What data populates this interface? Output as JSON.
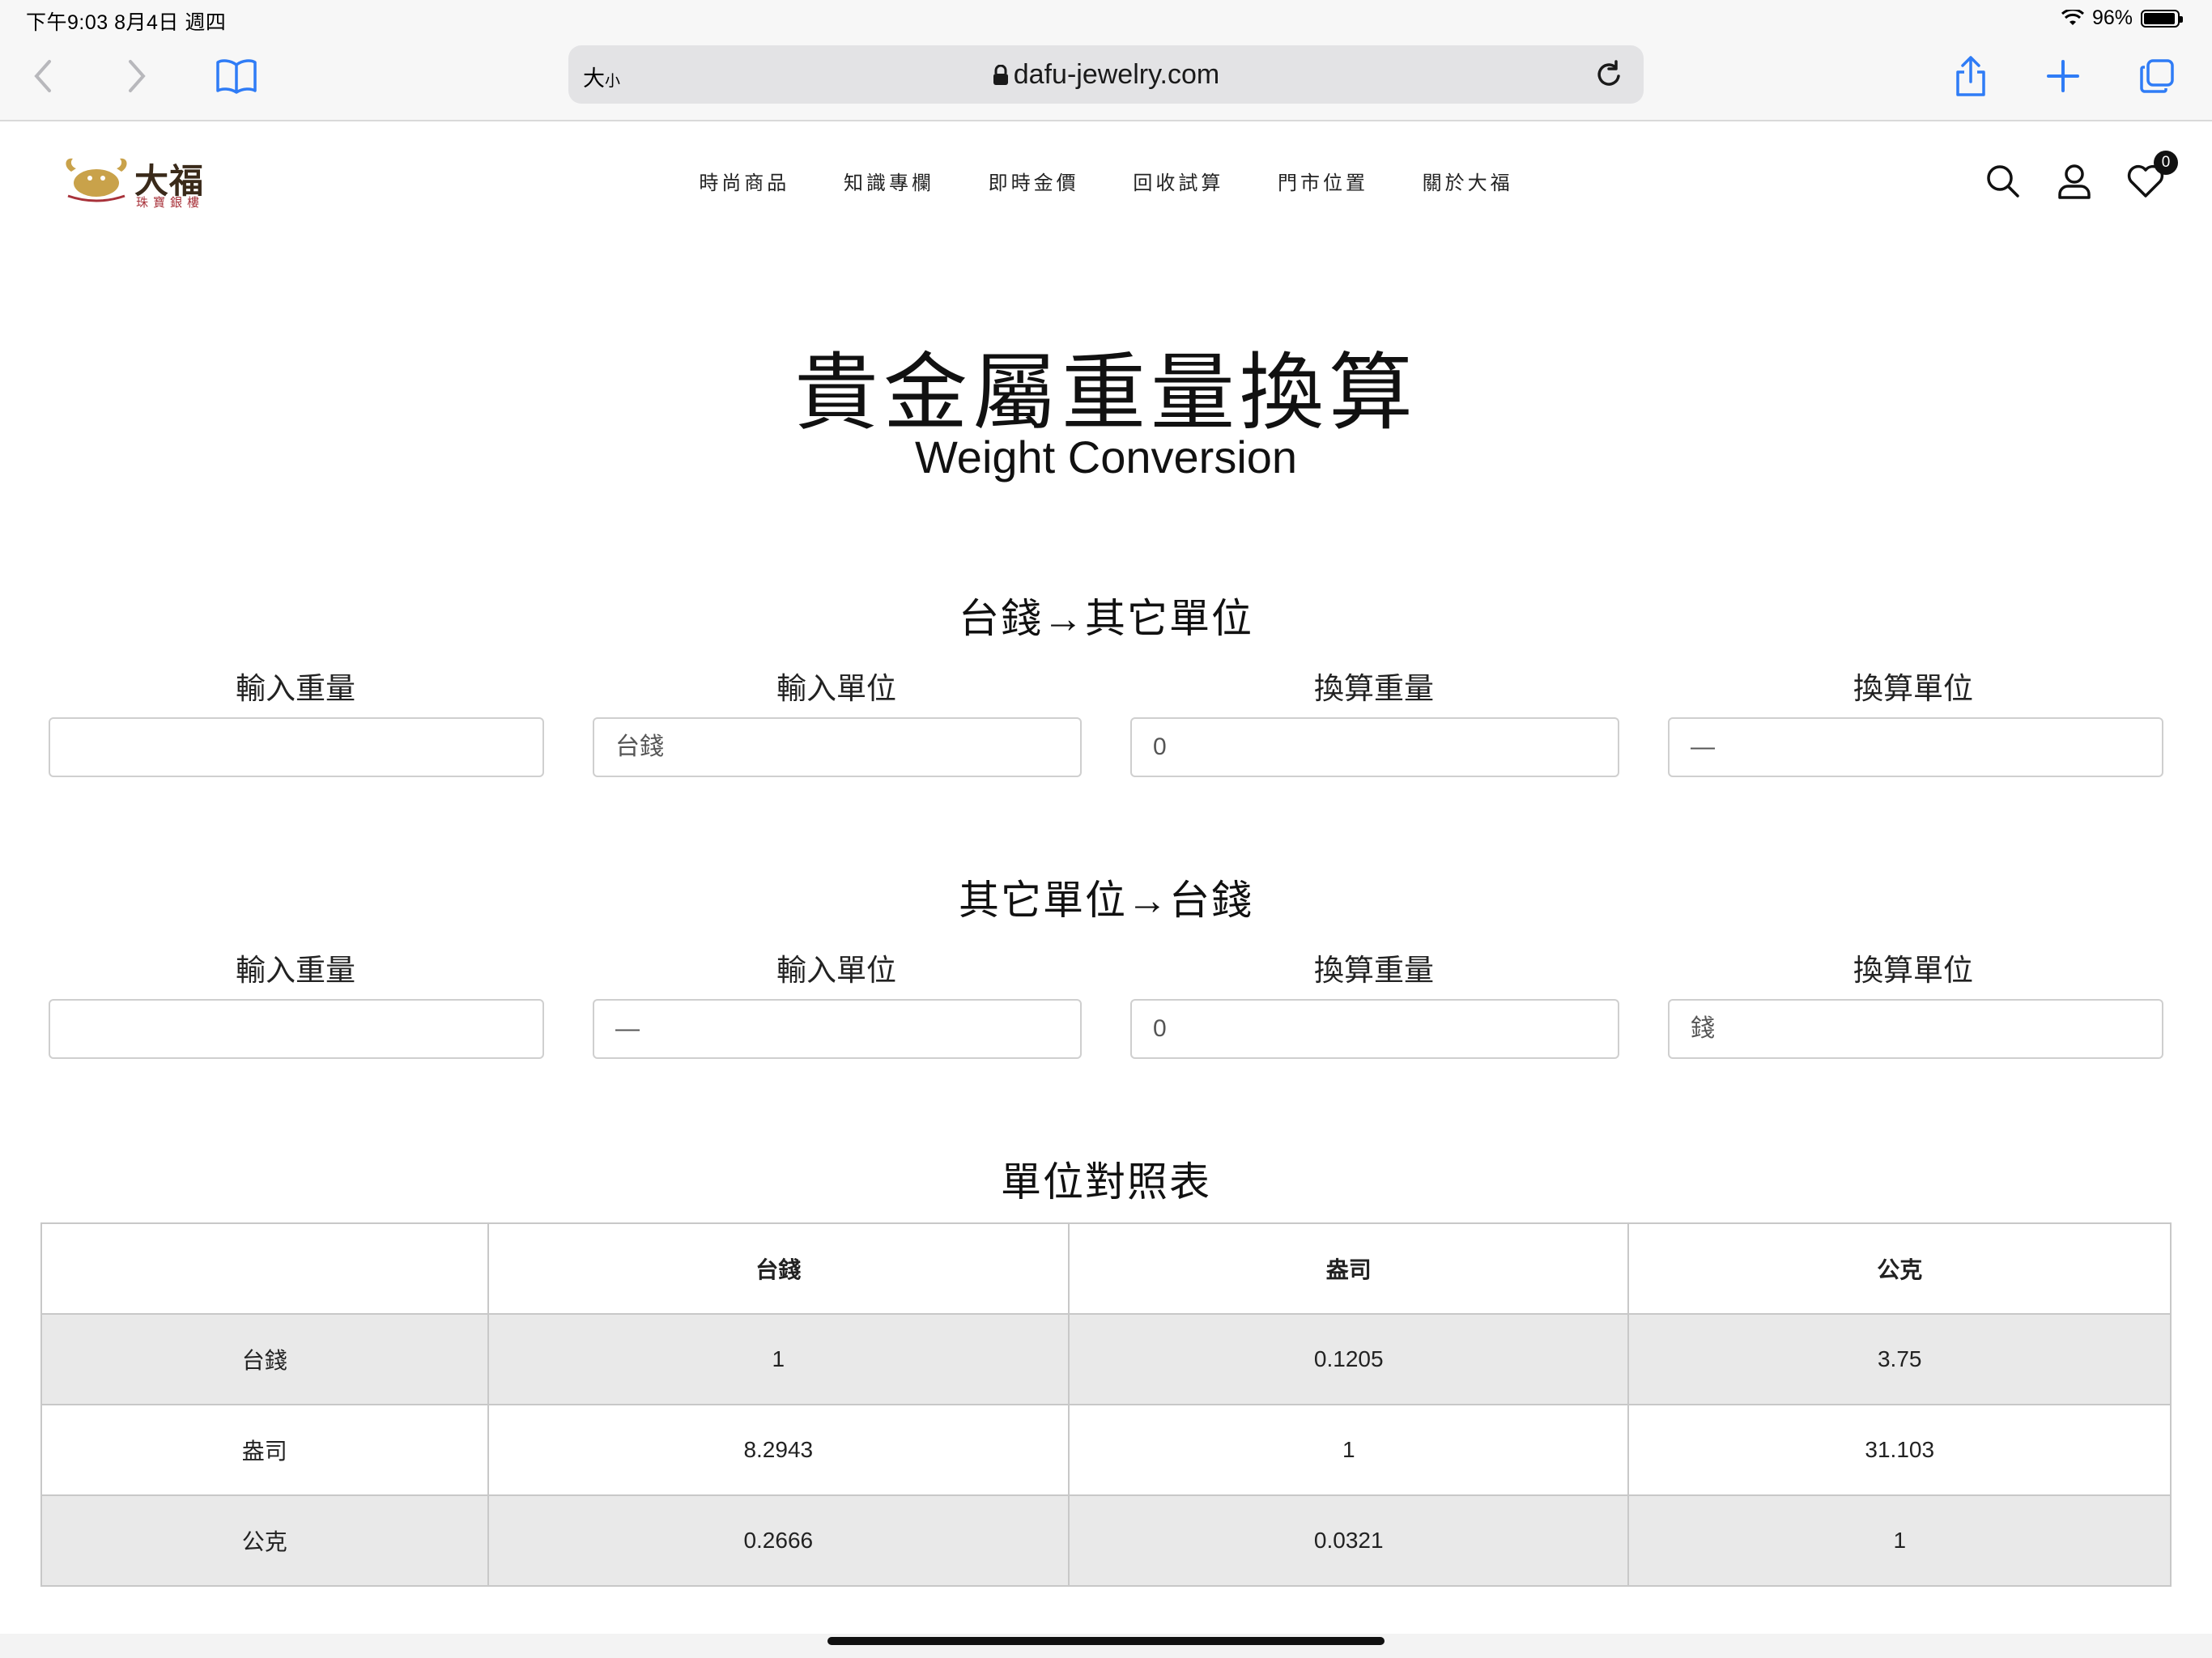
{
  "status_bar": {
    "time_date": "下午9:03   8月4日 週四",
    "battery": "96%",
    "battery_level": 0.96
  },
  "browser": {
    "text_size_label_big": "大",
    "text_size_label_small": "小",
    "url": "dafu-jewelry.com"
  },
  "site": {
    "logo_text": "大福",
    "logo_sub": "珠寶銀樓",
    "nav": [
      "時尚商品",
      "知識專欄",
      "即時金價",
      "回收試算",
      "門市位置",
      "關於大福"
    ],
    "wishlist_count": "0"
  },
  "page": {
    "title": "貴金屬重量換算",
    "subtitle": "Weight Conversion"
  },
  "section1": {
    "title": "台錢→其它單位",
    "labels": [
      "輸入重量",
      "輸入單位",
      "換算重量",
      "換算單位"
    ],
    "input_weight": "",
    "input_unit": "台錢",
    "result_weight": "0",
    "result_unit": "—"
  },
  "section2": {
    "title": "其它單位→台錢",
    "labels": [
      "輸入重量",
      "輸入單位",
      "換算重量",
      "換算單位"
    ],
    "input_weight": "",
    "input_unit": "—",
    "result_weight": "0",
    "result_unit": "錢"
  },
  "table": {
    "title": "單位對照表",
    "headers": [
      "",
      "台錢",
      "盎司",
      "公克"
    ],
    "rows": [
      [
        "台錢",
        "1",
        "0.1205",
        "3.75"
      ],
      [
        "盎司",
        "8.2943",
        "1",
        "31.103"
      ],
      [
        "公克",
        "0.2666",
        "0.0321",
        "1"
      ]
    ]
  },
  "colors": {
    "accent_link": "#2f7cf6",
    "table_shade": "#e9e9e9",
    "logo_gold": "#c9a24a",
    "logo_red": "#a8323a"
  }
}
